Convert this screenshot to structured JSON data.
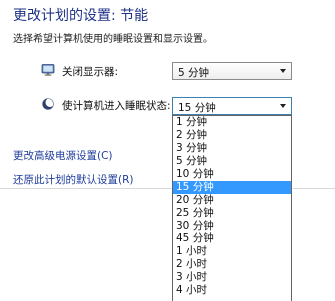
{
  "header": {
    "title": "更改计划的设置: 节能",
    "subtitle": "选择希望计算机使用的睡眠设置和显示设置。"
  },
  "settings": {
    "display_off": {
      "label": "关闭显示器:",
      "value": "5 分钟",
      "icon": "monitor-icon"
    },
    "sleep": {
      "label": "使计算机进入睡眠状态:",
      "value": "15 分钟",
      "icon": "moon-icon"
    }
  },
  "links": {
    "advanced": "更改高级电源设置(C)",
    "restore": "还原此计划的默认设置(R)"
  },
  "dropdown": {
    "selected_index": 5,
    "options": [
      "1 分钟",
      "2 分钟",
      "3 分钟",
      "5 分钟",
      "10 分钟",
      "15 分钟",
      "20 分钟",
      "25 分钟",
      "30 分钟",
      "45 分钟",
      "1 小时",
      "2 小时",
      "3 小时",
      "4 小时"
    ]
  },
  "colors": {
    "title": "#1e3287",
    "link": "#1e3c9b",
    "selection": "#3399ff"
  }
}
